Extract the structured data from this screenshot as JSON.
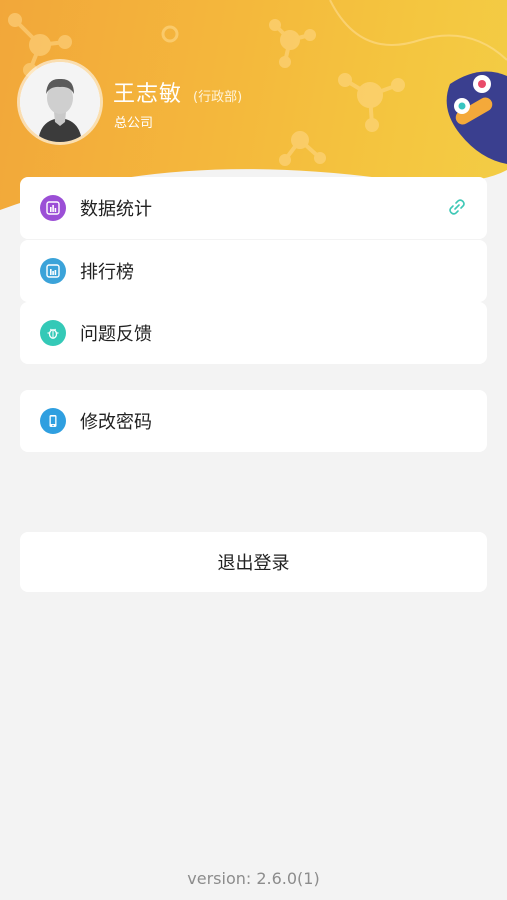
{
  "profile": {
    "name": "王志敏",
    "department": "(行政部)",
    "company": "总公司"
  },
  "menu": {
    "group1": [
      {
        "label": "数据统计",
        "icon": "bar-chart-icon",
        "color": "#9b4fd6"
      },
      {
        "label": "排行榜",
        "icon": "ranking-icon",
        "color": "#3ba3d9"
      },
      {
        "label": "问题反馈",
        "icon": "bug-icon",
        "color": "#34c9b7"
      }
    ],
    "group2": [
      {
        "label": "修改密码",
        "icon": "phone-lock-icon",
        "color": "#2f9fe0"
      }
    ]
  },
  "logout_label": "退出登录",
  "version_text": "version: 2.6.0(1)",
  "colors": {
    "header_start": "#f2a73a",
    "header_end": "#f3cd45",
    "link_icon": "#3ec8b6"
  }
}
